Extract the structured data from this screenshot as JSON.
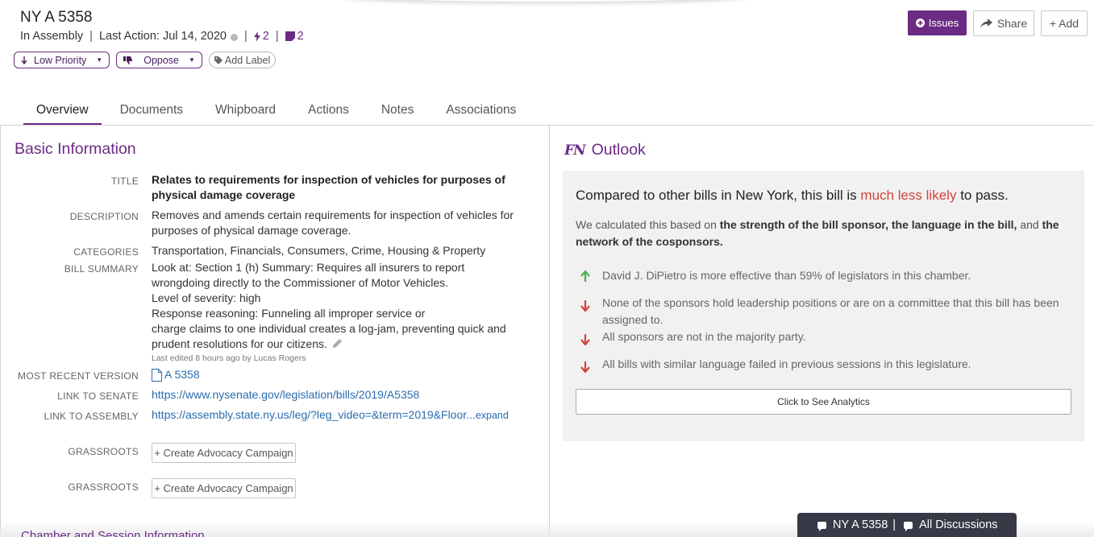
{
  "header": {
    "title": "NY A 5358",
    "status": "In Assembly",
    "last_action": "Last Action: Jul 14, 2020",
    "sep": "|",
    "actions_count": "2",
    "notes_count": "2"
  },
  "pills": {
    "priority": "Low Priority",
    "position": "Oppose",
    "label": "Add Label"
  },
  "toolbar": {
    "issues": "Issues",
    "share": "Share",
    "add": "+ Add"
  },
  "tabs": [
    "Overview",
    "Documents",
    "Whipboard",
    "Actions",
    "Notes",
    "Associations"
  ],
  "basic_info": {
    "heading": "Basic Information",
    "title_label": "TITLE",
    "title_lines": [
      "Relates to requirements for inspection of vehicles for purposes of",
      "physical damage coverage"
    ],
    "description_label": "DESCRIPTION",
    "description_lines": [
      "Removes and amends certain requirements for inspection of vehicles for",
      "purposes of physical damage coverage."
    ],
    "categories_label": "CATEGORIES",
    "categories": "Transportation, Financials, Consumers, Crime, Housing & Property",
    "summary_label": "BILL SUMMARY",
    "summary_lines": [
      "Look at: Section 1 (h) Summary: Requires all insurers to report",
      "wrongdoing directly to the Commissioner of Motor Vehicles.",
      "Level of severity: high",
      "Response reasoning: Funneling all improper service or",
      "charge claims to one individual creates a log-jam, preventing quick and",
      "prudent resolutions for our citizens."
    ],
    "last_edited": "Last edited 8 hours ago by Lucas Rogers",
    "version_label": "MOST RECENT VERSION",
    "version": "A 5358",
    "senate_label": "LINK TO SENATE",
    "senate_link": "https://www.nysenate.gov/legislation/bills/2019/A5358",
    "assembly_label": "LINK TO ASSEMBLY",
    "assembly_link": "https://assembly.state.ny.us/leg/?leg_video=&term=2019&Floor...",
    "expand": "expand",
    "grassroots_label": "GRASSROOTS",
    "advocacy_button": "+ Create Advocacy Campaign"
  },
  "chamber_heading": "Chamber and Session Information",
  "outlook": {
    "logo": "FN",
    "heading": "Outlook",
    "compare_prefix": "Compared to other bills in New York, this bill is",
    "compare_highlight": "much less likely",
    "compare_suffix": "to pass.",
    "calc_prefix": "We calculated this based on",
    "calc_bold_1": "the strength of the bill sponsor, the language in the bill,",
    "calc_and": "and",
    "calc_bold_2": "the network of the cosponsors.",
    "factors": [
      {
        "direction": "up",
        "text": "David J. DiPietro is more effective than 59% of legislators in this chamber."
      },
      {
        "direction": "down",
        "text": "None of the sponsors hold leadership positions or are on a committee that this bill has been assigned to."
      },
      {
        "direction": "down",
        "text": "All sponsors are not in the majority party."
      },
      {
        "direction": "down",
        "text": "All bills with similar language failed in previous sessions in this legislature."
      }
    ],
    "analytics_button": "Click to See Analytics"
  },
  "discussion": {
    "bill": "NY A 5358",
    "sep": "|",
    "all": "All Discussions"
  },
  "colors": {
    "brand": "#6b2b83",
    "likelihood": "#d0443a",
    "up": "#4caf50",
    "down": "#d0443a"
  }
}
